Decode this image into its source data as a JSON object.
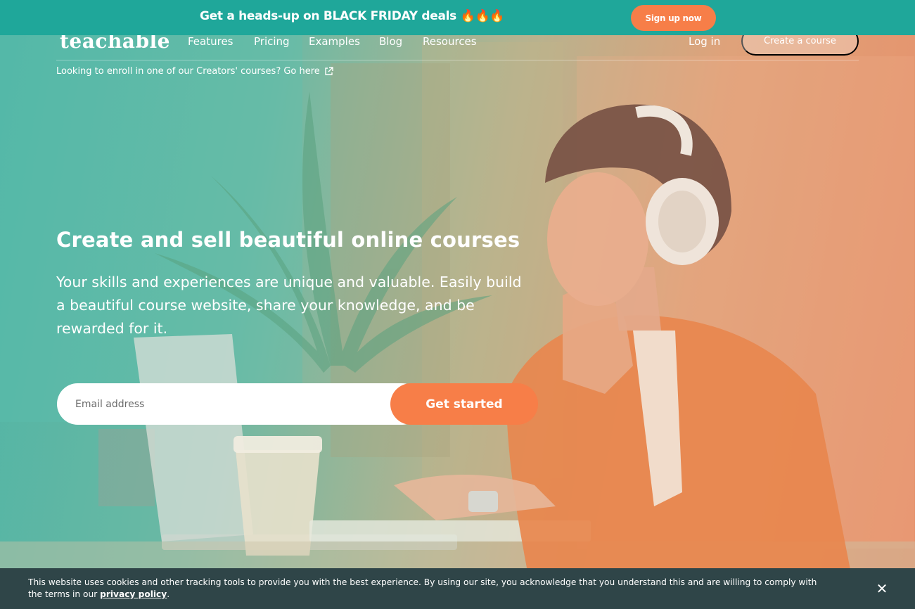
{
  "promo": {
    "text": "Get a heads-up on BLACK FRIDAY deals 🔥🔥🔥",
    "button_label": "Sign up now"
  },
  "nav": {
    "logo": "teachable",
    "links": [
      "Features",
      "Pricing",
      "Examples",
      "Blog",
      "Resources"
    ],
    "login": "Log in",
    "cta": "Create a course"
  },
  "enroll_note": "Looking to enroll in one of our Creators' courses? Go here",
  "hero": {
    "headline": "Create and sell beautiful online courses",
    "subcopy": "Your skills and experiences are unique and valuable. Easily build a beautiful course website, share your knowledge, and be rewarded for it."
  },
  "signup": {
    "email_placeholder": "Email address",
    "email_value": "",
    "button_label": "Get started"
  },
  "cookie": {
    "text": "This website uses cookies and other tracking tools to provide you with the best experience. By using our site, you acknowledge that you understand this and are willing to comply with the terms in our",
    "link_label": "privacy policy",
    "close_glyph": "✕"
  },
  "colors": {
    "promo_bar": "#1fa79a",
    "accent_orange": "#f77e48",
    "cookie_bar": "#2f4548"
  },
  "icons": {
    "external_link": "external-link-icon",
    "close": "close-icon"
  }
}
